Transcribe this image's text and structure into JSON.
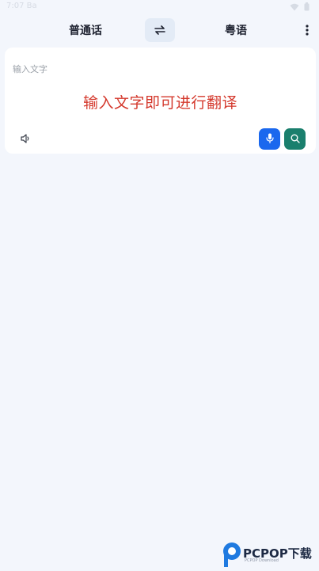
{
  "status_bar": {
    "time": "7:07 Ba",
    "icons": [
      "wifi-icon",
      "battery-icon"
    ]
  },
  "top_bar": {
    "source_language": "普通话",
    "target_language": "粤语",
    "swap_icon": "swap-arrows-icon",
    "more_icon": "more-vertical-icon"
  },
  "input_card": {
    "placeholder": "输入文字",
    "hint": "输入文字即可进行翻译",
    "speaker_icon": "speaker-icon",
    "mic_icon": "microphone-icon",
    "search_icon": "search-icon"
  },
  "colors": {
    "page_background": "#f3f6fc",
    "card_background": "#ffffff",
    "hint_text": "#d4382c",
    "mic_button": "#1b68ee",
    "search_button": "#1a7f6d",
    "swap_button": "#e3ebf6"
  },
  "watermark": {
    "brand": "PCPOP下载",
    "subtitle": "PCPOP Download"
  }
}
